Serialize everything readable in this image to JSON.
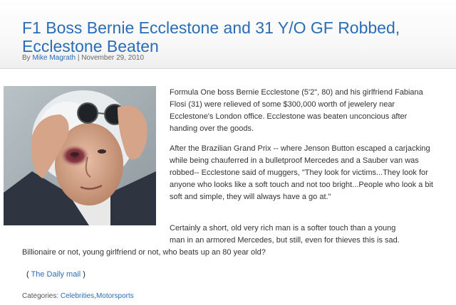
{
  "post": {
    "title": "F1 Boss Bernie Ecclestone and 31 Y/O GF Robbed, Ecclestone Beaten",
    "byline": {
      "prefix": "By",
      "author": "Mike Magrath",
      "separator": "|",
      "date": "November 29, 2010"
    },
    "image": {
      "alt": "Bernie Ecclestone with bruised eye removing sunglasses"
    },
    "paragraphs": {
      "p1": "Formula One boss Bernie Ecclestone (5'2\", 80) and his girlfriend Fabiana Flosi (31) were relieved of some $300,000 worth of jewelery near Ecclestone's London office. Ecclestone was beaten unconcious after handing over the goods.",
      "p2": "After the Brazilian Grand Prix -- where Jenson Button escaped a carjacking while being chauferred in a bulletproof Mercedes and a Sauber van was robbed-- Ecclestone said of muggers, \"They look for victims...They look for anyone who looks like a soft touch and not too bright...People who look a bit soft and simple, they will always have a go at.\"",
      "p3_line1": "Certainly a short, old very rich man is a softer touch than a young",
      "p3_line2": "man in an armored Mercedes, but still, even for thieves this is sad.",
      "p3_line3": "Billionaire or not, young girlfriend or not, who beats up an 80 year old?"
    },
    "source": {
      "open": "(",
      "link": "The Daily mail",
      "close": ")"
    },
    "categories": {
      "label": "Categories:",
      "items": [
        "Celebrities",
        "Motorsports"
      ],
      "separator": ","
    }
  }
}
